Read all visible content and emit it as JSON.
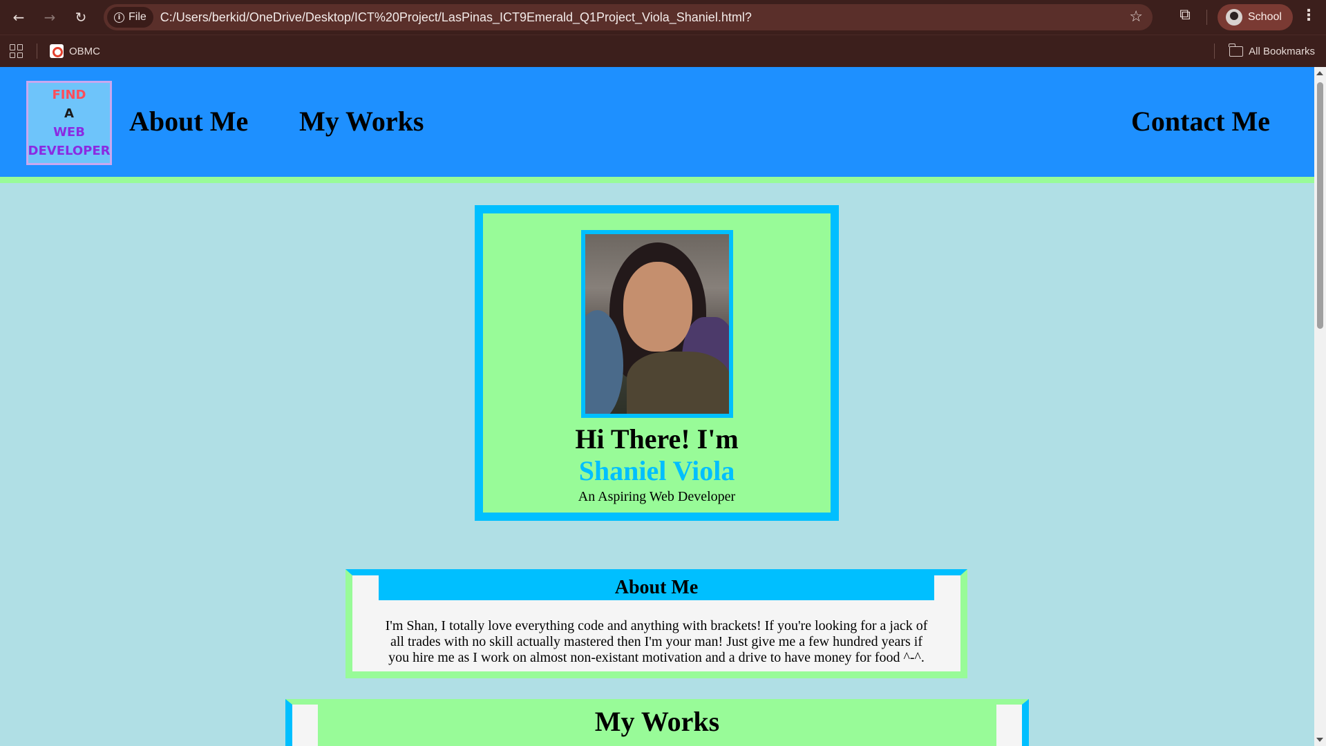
{
  "browser": {
    "file_label": "File",
    "url": "C:/Users/berkid/OneDrive/Desktop/ICT%20Project/LasPinas_ICT9Emerald_Q1Project_Viola_Shaniel.html?",
    "profile_label": "School",
    "bookmark_obmc": "OBMC",
    "all_bookmarks": "All Bookmarks"
  },
  "logo": {
    "line1": "FIND",
    "line2": "A",
    "line3": "WEB",
    "line4": "DEVELOPER"
  },
  "nav": {
    "about": "About Me",
    "works": "My Works",
    "contact": "Contact Me"
  },
  "hero": {
    "greeting": "Hi There! I'm",
    "name": "Shaniel Viola",
    "tagline": "An Aspiring Web Developer"
  },
  "about": {
    "heading": "About Me",
    "body": "I'm Shan, I totally love everything code and anything with brackets! If you're looking for a jack of all trades with no skill actually mastered then I'm your man! Just give me a few hundred years if you hire me as I work on almost non-existant motivation and a drive to have money for food ^-^."
  },
  "works": {
    "heading": "My Works"
  },
  "colors": {
    "header_bg": "#1e90ff",
    "page_bg": "#b0dfe5",
    "accent_green": "#98fb98",
    "accent_blue": "#00bfff"
  }
}
